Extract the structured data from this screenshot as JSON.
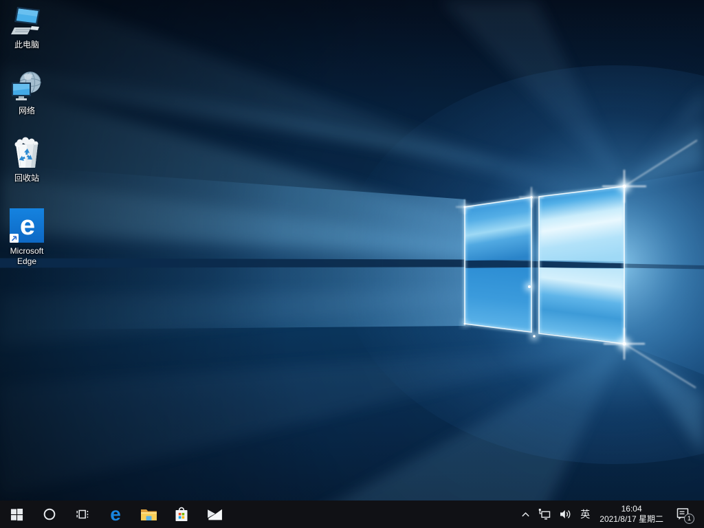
{
  "desktop": {
    "icons": [
      {
        "label": "此电脑",
        "icon": "this-pc-icon"
      },
      {
        "label": "网络",
        "icon": "network-icon"
      },
      {
        "label": "回收站",
        "icon": "recycle-bin-icon"
      },
      {
        "label": "Microsoft Edge",
        "icon": "edge-icon"
      }
    ]
  },
  "taskbar": {
    "buttons": [
      {
        "name": "start",
        "icon": "windows-logo-icon"
      },
      {
        "name": "cortana",
        "icon": "cortana-circle-icon"
      },
      {
        "name": "task-view",
        "icon": "task-view-icon"
      },
      {
        "name": "edge",
        "icon": "edge-e-icon"
      },
      {
        "name": "file-explorer",
        "icon": "folder-icon"
      },
      {
        "name": "store",
        "icon": "store-bag-icon"
      },
      {
        "name": "mail",
        "icon": "mail-envelope-icon"
      }
    ],
    "tray": {
      "hidden_icons": {
        "icon": "chevron-up-icon"
      },
      "network": {
        "icon": "ethernet-icon"
      },
      "volume": {
        "icon": "speaker-icon"
      },
      "input_indicator": "英",
      "clock": {
        "time": "16:04",
        "date": "2021/8/17 星期二"
      },
      "action_center": {
        "icon": "notification-icon"
      },
      "notification_badge": "1"
    }
  },
  "colors": {
    "taskbar_bg": "#101115",
    "accent_blue": "#0078d7",
    "wallpaper_dark": "#071a31",
    "wallpaper_glow": "#8fd2f4",
    "icon_text": "#ffffff"
  }
}
